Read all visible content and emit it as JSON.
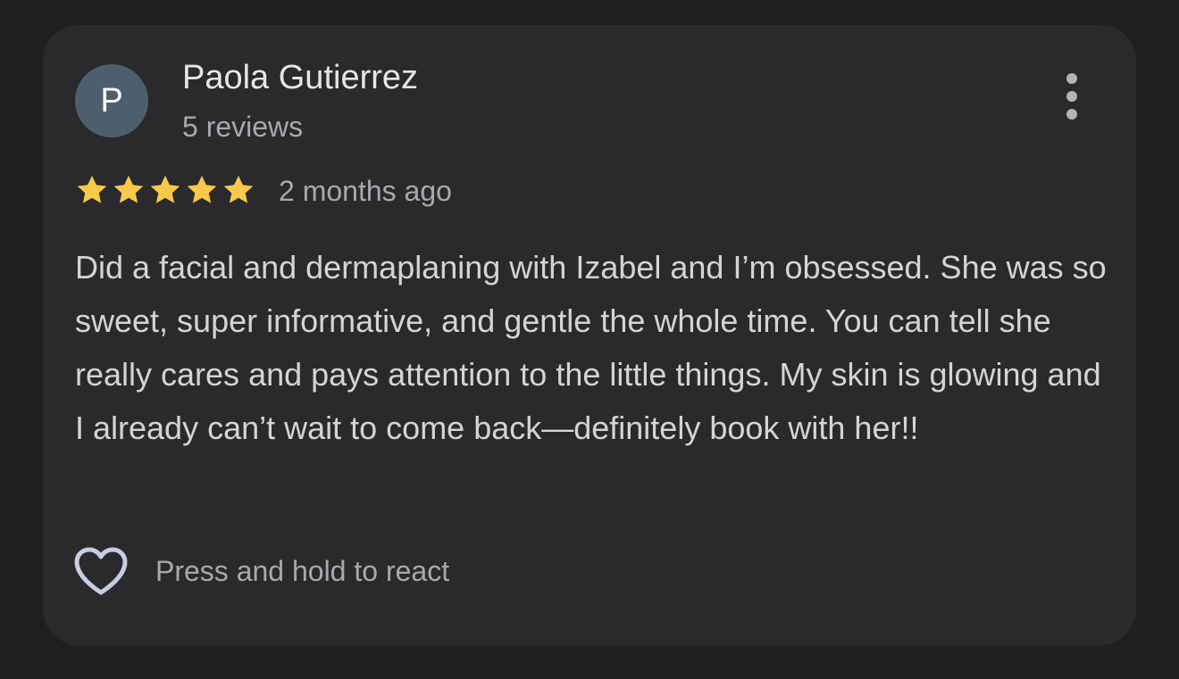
{
  "review": {
    "avatar_initial": "P",
    "reviewer_name": "Paola Gutierrez",
    "review_count": "5 reviews",
    "rating": 5,
    "rating_max": 5,
    "time_ago": "2 months ago",
    "text": "Did a facial and dermaplaning with Izabel and I’m obsessed. She was so sweet, super informative, and gentle the whole time. You can tell she really cares and pays attention to the little things. My skin is glowing and I already can’t wait to come back—definitely book with her!!",
    "react_label": "Press and hold to react"
  },
  "icons": {
    "more": "more-vert-icon",
    "star": "star-icon",
    "heart": "heart-outline-icon"
  },
  "colors": {
    "background": "#1f1f20",
    "card": "#2a2a2c",
    "avatar": "#4d5f6c",
    "star": "#f8c94a",
    "heart": "#c9cde2"
  }
}
